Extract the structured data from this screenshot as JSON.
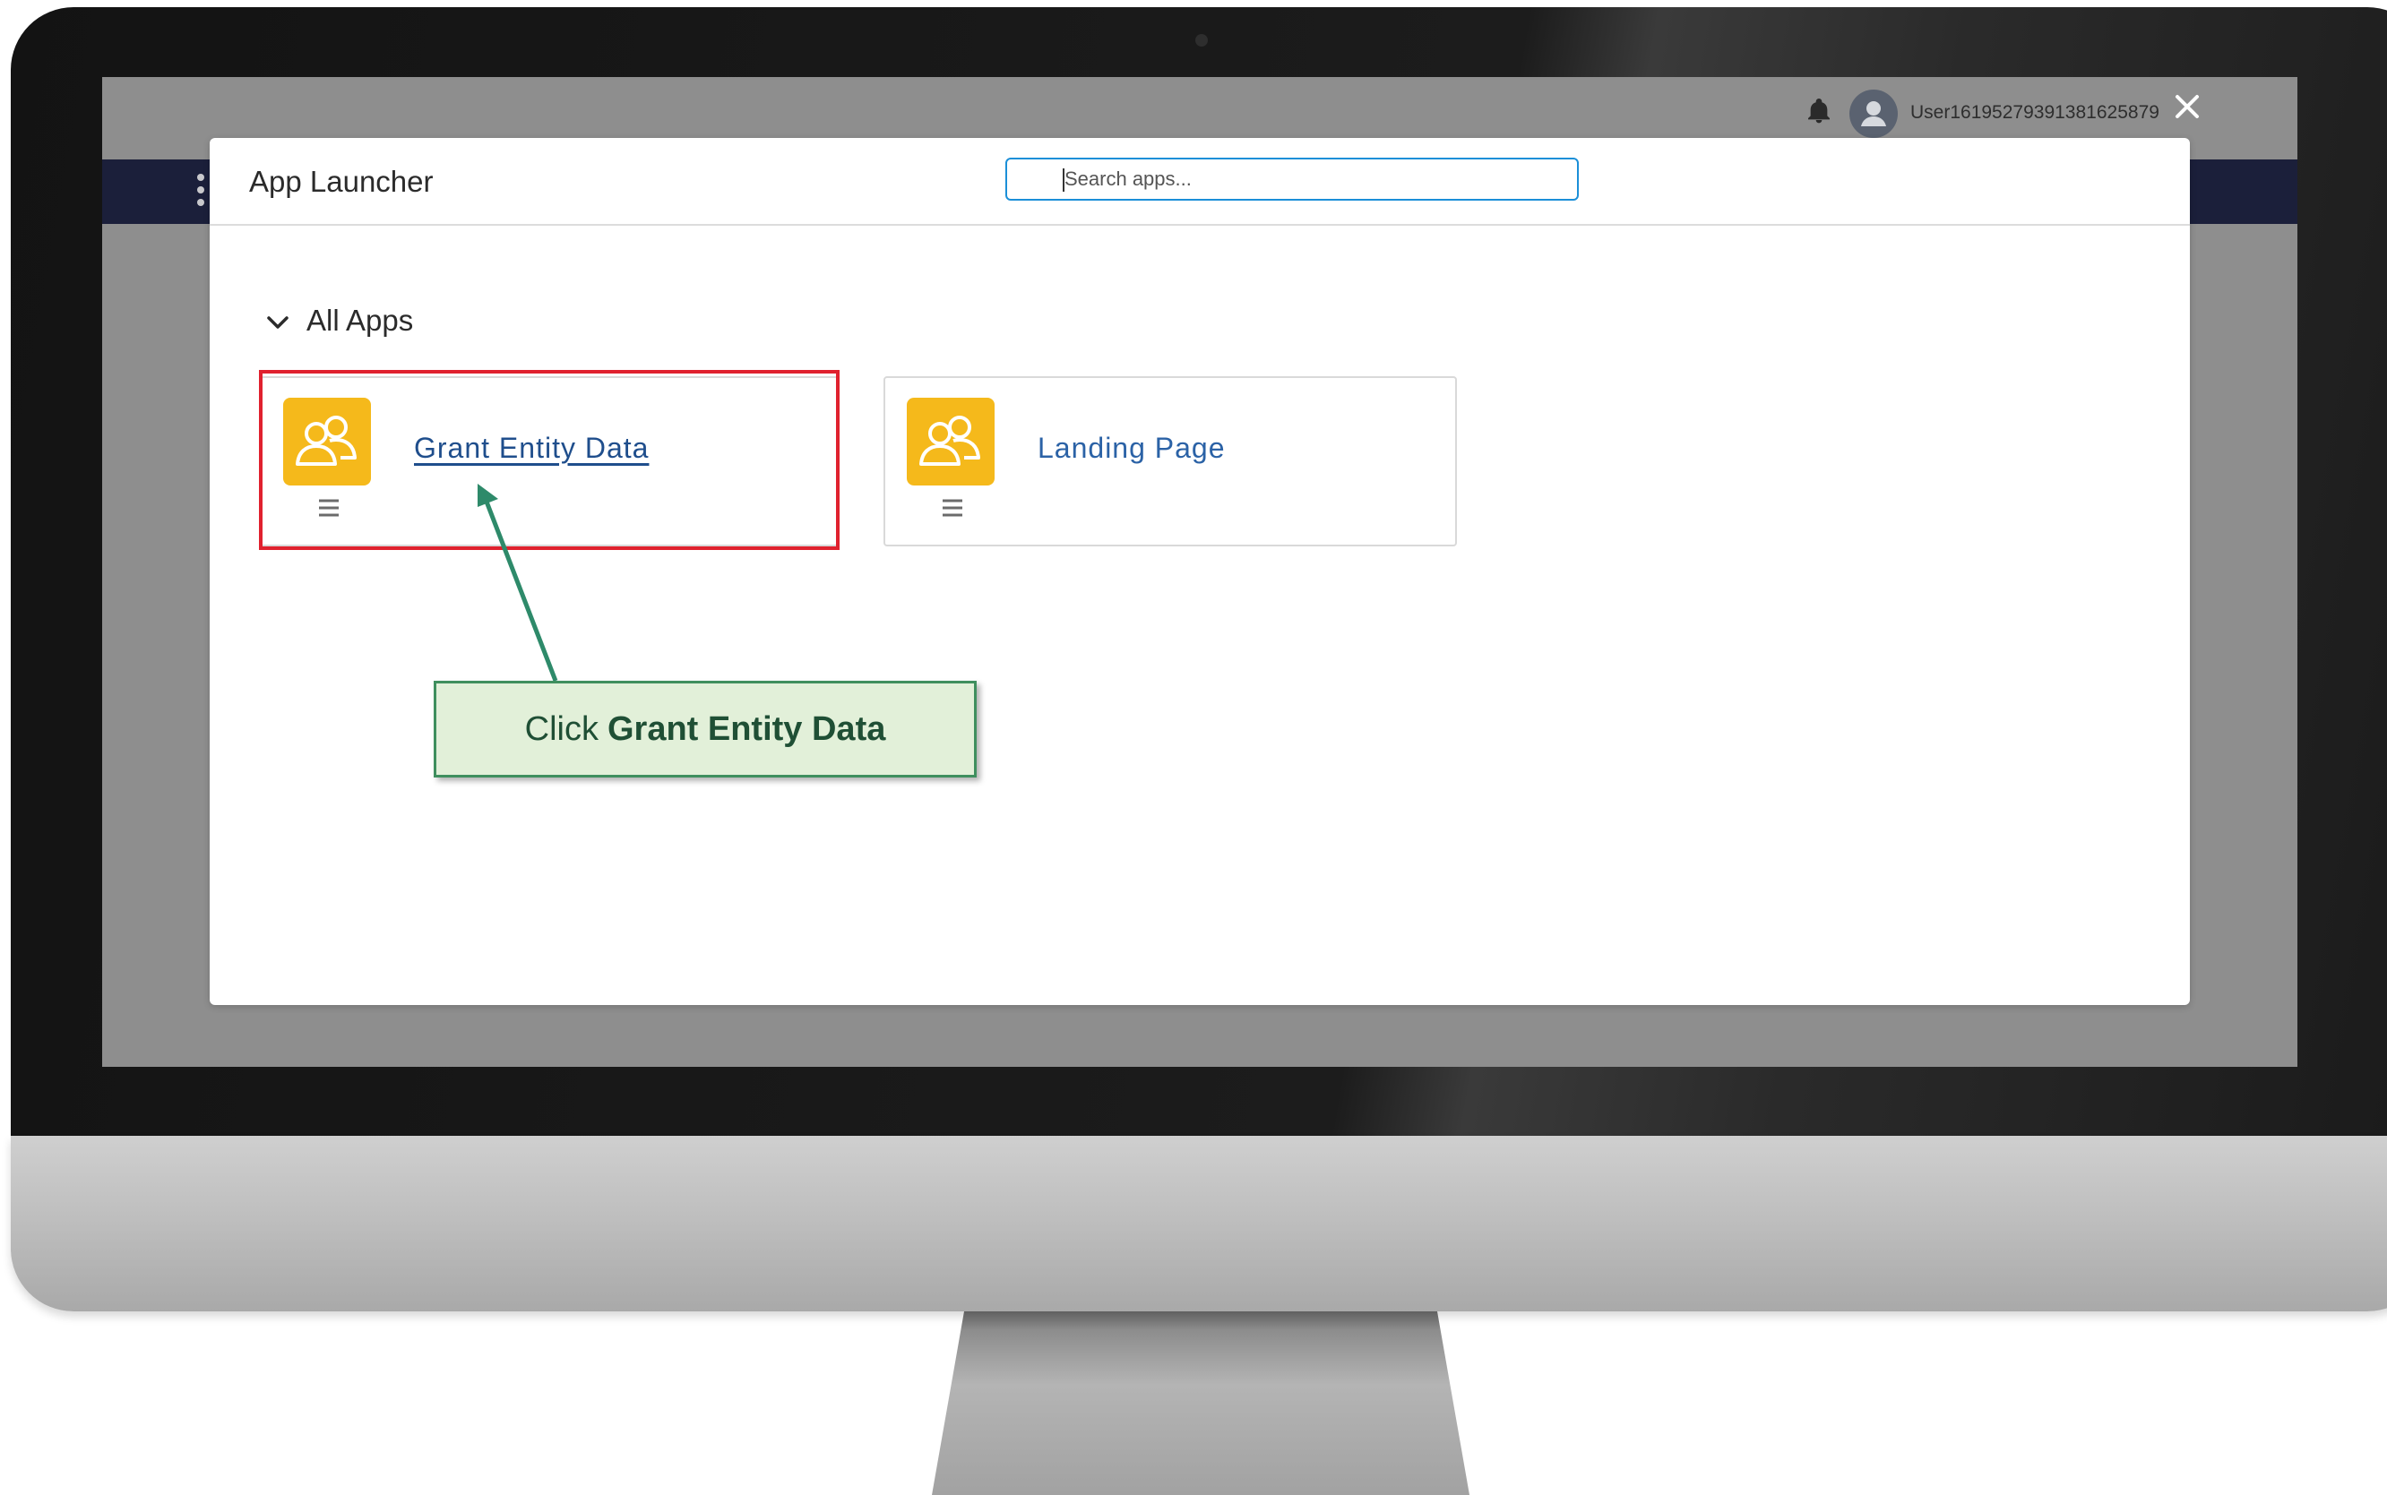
{
  "screen": {
    "header": {
      "username": "User16195279391381625879"
    }
  },
  "app_launcher": {
    "title": "App Launcher",
    "search": {
      "placeholder": "Search apps...",
      "value": ""
    },
    "section": {
      "label": "All Apps"
    },
    "apps": [
      {
        "name": "Grant Entity Data",
        "icon": "users-group-icon"
      },
      {
        "name": "Landing Page",
        "icon": "users-group-icon"
      }
    ]
  },
  "callout": {
    "prefix": "Click",
    "target": "Grant Entity Data"
  },
  "colors": {
    "navbar": "#1b1f3a",
    "app_icon": "#f5b91b",
    "link": "#2b62a6",
    "search_border": "#1b8fd8",
    "highlight": "#e0212e",
    "callout_fill": "#e2f0d9",
    "callout_border": "#3f8f5e"
  }
}
